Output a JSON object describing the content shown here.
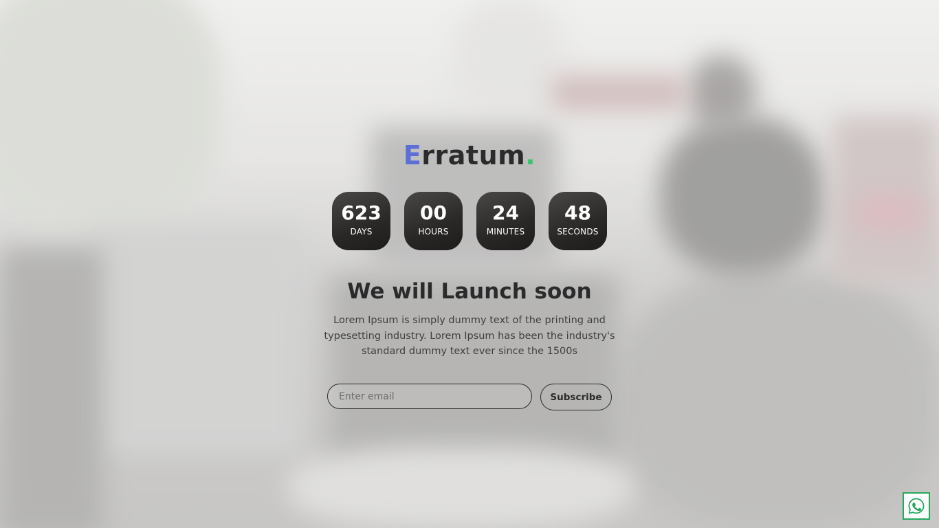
{
  "logo": {
    "first_letter": "E",
    "rest": "rratum",
    "dot": "."
  },
  "countdown": [
    {
      "value": "623",
      "label": "DAYS"
    },
    {
      "value": "00",
      "label": "HOURS"
    },
    {
      "value": "24",
      "label": "MINUTES"
    },
    {
      "value": "48",
      "label": "SECONDS"
    }
  ],
  "headline": "We will Launch soon",
  "description": "Lorem Ipsum is simply dummy text of the printing and typesetting industry. Lorem Ipsum has been the industry's standard dummy text ever since the 1500s",
  "subscribe_form": {
    "email_placeholder": "Enter email",
    "email_value": "",
    "button_label": "Subscribe"
  },
  "floating": {
    "icon": "whatsapp-icon"
  },
  "colors": {
    "logo_accent": "#5b6fd6",
    "logo_dot": "#3bc46e",
    "whatsapp": "#25a95d",
    "text_dark": "#2b2b2b"
  }
}
